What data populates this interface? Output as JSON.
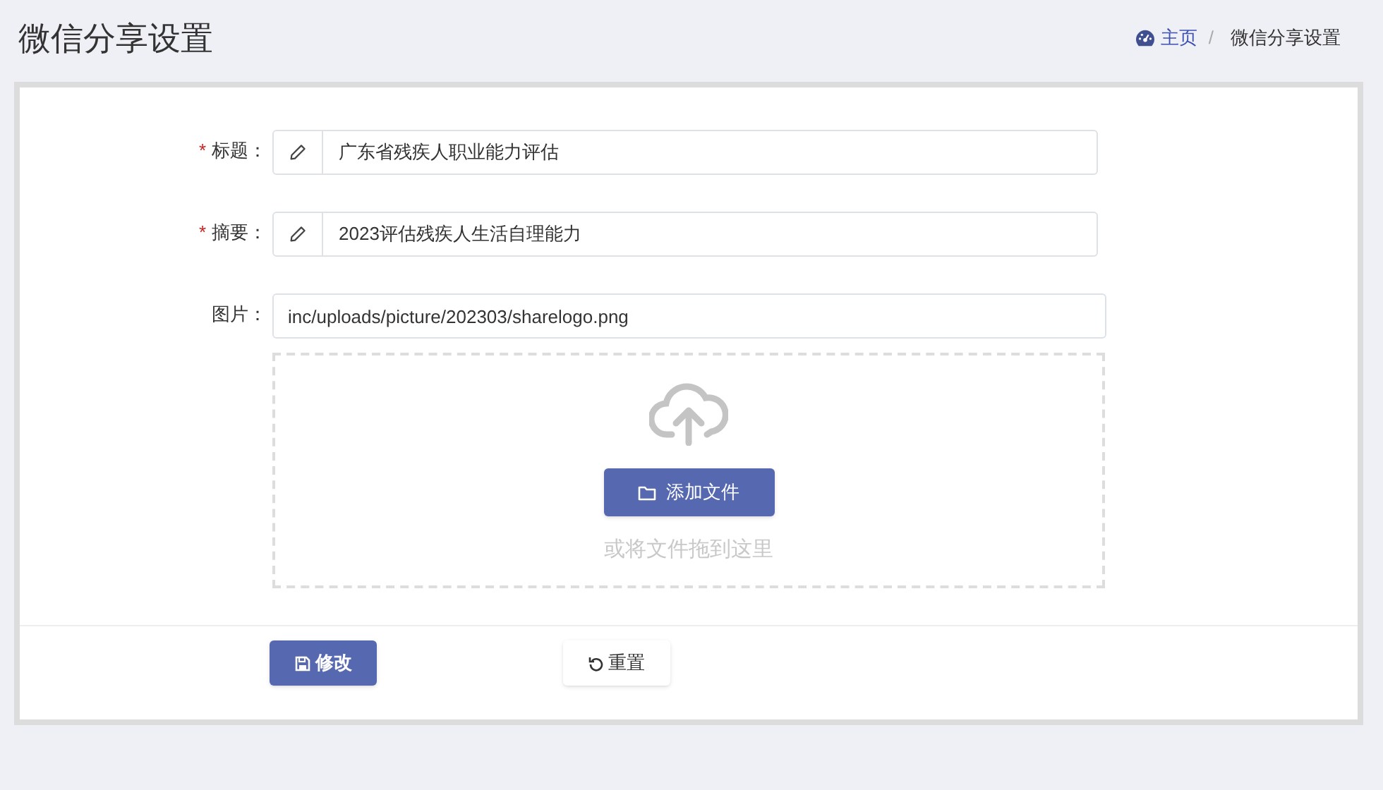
{
  "page_title": "微信分享设置",
  "breadcrumb_separator": "/",
  "required_mark": "*",
  "breadcrumb": [
    {
      "label": "主页",
      "kind": "link"
    },
    {
      "label": "微信分享设置",
      "kind": "current"
    }
  ],
  "fields": [
    {
      "label": "标题：",
      "required": true,
      "kind": "icon-input",
      "value": "广东省残疾人职业能力评估"
    },
    {
      "label": "摘要：",
      "required": true,
      "kind": "icon-input",
      "value": "2023评估残疾人生活自理能力"
    },
    {
      "label": "图片：",
      "required": false,
      "kind": "upload",
      "value": "inc/uploads/picture/202303/sharelogo.png",
      "upload_button": "添加文件",
      "drop_hint": "或将文件拖到这里"
    }
  ],
  "buttons": [
    {
      "label": "修改",
      "kind": "primary"
    },
    {
      "label": "重置",
      "kind": "default"
    }
  ]
}
